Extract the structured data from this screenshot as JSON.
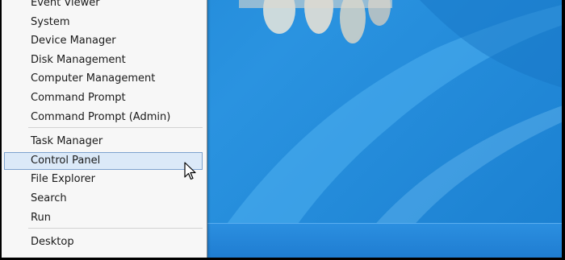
{
  "menu": {
    "group1": [
      "Event Viewer",
      "System",
      "Device Manager",
      "Disk Management",
      "Computer Management",
      "Command Prompt",
      "Command Prompt (Admin)"
    ],
    "group2": [
      "Task Manager",
      "Control Panel",
      "File Explorer",
      "Search",
      "Run"
    ],
    "group3": [
      "Desktop"
    ],
    "highlighted_item": "Control Panel"
  },
  "colors": {
    "desktop_blue": "#1f86d6",
    "menu_background": "#f7f7f7",
    "hover_fill": "#dbe9f8",
    "hover_border": "#7da2ce"
  },
  "icons": {
    "cursor": "mouse-pointer-icon"
  }
}
